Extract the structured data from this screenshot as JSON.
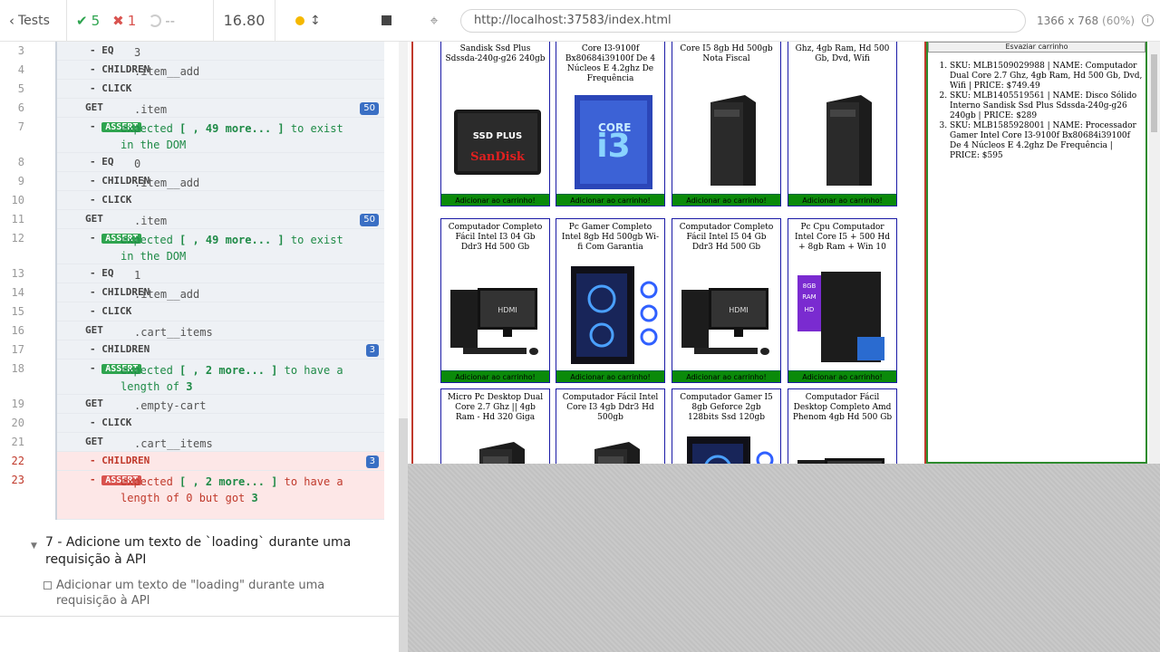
{
  "topbar": {
    "back_label": "Tests",
    "passed": "5",
    "failed": "1",
    "pending": "--",
    "duration": "16.80"
  },
  "commands": [
    {
      "n": "3",
      "name": "- EQ",
      "msg": "3",
      "child": true
    },
    {
      "n": "4",
      "name": "- CHILDREN",
      "msg": ".item__add",
      "child": true
    },
    {
      "n": "5",
      "name": "- CLICK",
      "msg": "",
      "child": true
    },
    {
      "n": "6",
      "name": "GET",
      "msg": ".item",
      "child": false,
      "badge": "50"
    },
    {
      "n": "7",
      "name": "- ASSERT",
      "msg": "expected [ <section.item>, 49 more... ] to exist in the DOM",
      "child": true,
      "assert": true
    },
    {
      "n": "8",
      "name": "- EQ",
      "msg": "0",
      "child": true
    },
    {
      "n": "9",
      "name": "- CHILDREN",
      "msg": ".item__add",
      "child": true
    },
    {
      "n": "10",
      "name": "- CLICK",
      "msg": "",
      "child": true
    },
    {
      "n": "11",
      "name": "GET",
      "msg": ".item",
      "child": false,
      "badge": "50"
    },
    {
      "n": "12",
      "name": "- ASSERT",
      "msg": "expected [ <section.item>, 49 more... ] to exist in the DOM",
      "child": true,
      "assert": true
    },
    {
      "n": "13",
      "name": "- EQ",
      "msg": "1",
      "child": true
    },
    {
      "n": "14",
      "name": "- CHILDREN",
      "msg": ".item__add",
      "child": true
    },
    {
      "n": "15",
      "name": "- CLICK",
      "msg": "",
      "child": true
    },
    {
      "n": "16",
      "name": "GET",
      "msg": ".cart__items",
      "child": false
    },
    {
      "n": "17",
      "name": "- CHILDREN",
      "msg": "",
      "child": true,
      "badge": "3"
    },
    {
      "n": "18",
      "name": "- ASSERT",
      "msg": "expected [ <li.cart__item>, 2 more... ] to have a length of 3",
      "child": true,
      "assert": true
    },
    {
      "n": "19",
      "name": "GET",
      "msg": ".empty-cart",
      "child": false
    },
    {
      "n": "20",
      "name": "- CLICK",
      "msg": "",
      "child": true
    },
    {
      "n": "21",
      "name": "GET",
      "msg": ".cart__items",
      "child": false
    },
    {
      "n": "22",
      "name": "- CHILDREN",
      "msg": "",
      "child": true,
      "badge": "3",
      "fail": true
    },
    {
      "n": "23",
      "name": "- ASSERT",
      "msg": "expected [ <li.cart__item>, 2 more... ] to have a length of 0 but got 3",
      "child": true,
      "assert": true,
      "fail": true
    }
  ],
  "test7": {
    "title": "7 - Adicione um texto de `loading` durante uma requisição à API",
    "sub": "Adicionar um texto de \"loading\" durante uma requisição à API"
  },
  "aut": {
    "url": "http://localhost:37583/index.html",
    "viewport": "1366 x 768",
    "scale": "(60%)"
  },
  "products": [
    {
      "title": "Sandisk Ssd Plus Sdssda-240g-g26 240gb",
      "kind": "ssd"
    },
    {
      "title": "Core I3-9100f Bx80684i39100f De 4 Núcleos E 4.2ghz De Frequência",
      "kind": "cpu"
    },
    {
      "title": "Core I5 8gb Hd 500gb Nota Fiscal",
      "kind": "tower"
    },
    {
      "title": "Ghz, 4gb Ram, Hd 500 Gb, Dvd, Wifi",
      "kind": "tower"
    },
    {
      "title": "Computador Completo Fácil Intel I3 04 Gb Ddr3 Hd 500 Gb",
      "kind": "setup"
    },
    {
      "title": "Pc Gamer Completo Intel 8gb Hd 500gb Wi-fi Com Garantia",
      "kind": "gamer"
    },
    {
      "title": "Computador Completo Fácil Intel I5 04 Gb Ddr3 Hd 500 Gb",
      "kind": "setup"
    },
    {
      "title": "Pc Cpu Computador Intel Core I5 + 500 Hd + 8gb Ram + Win 10",
      "kind": "spec"
    },
    {
      "title": "Micro Pc Desktop Dual Core 2.7 Ghz || 4gb Ram - Hd 320 Giga",
      "kind": "tower"
    },
    {
      "title": "Computador Fácil Intel Core I3 4gb Ddr3 Hd 500gb",
      "kind": "tower"
    },
    {
      "title": "Computador Gamer I5 8gb Geforce 2gb 128bits Ssd 120gb",
      "kind": "gamer"
    },
    {
      "title": "Computador Fácil Desktop Completo Amd Phenom 4gb Hd 500 Gb",
      "kind": "setup"
    }
  ],
  "add_label": "Adicionar ao carrinho!",
  "cart": {
    "empty_label": "Esvaziar carrinho",
    "items": [
      "SKU: MLB1509029988 | NAME: Computador Dual Core 2.7 Ghz, 4gb Ram, Hd 500 Gb, Dvd, Wifi | PRICE: $749.49",
      "SKU: MLB1405519561 | NAME: Disco Sólido Interno Sandisk Ssd Plus Sdssda-240g-g26 240gb | PRICE: $289",
      "SKU: MLB1585928001 | NAME: Processador Gamer Intel Core I3-9100f Bx80684i39100f De 4 Núcleos E 4.2ghz De Frequência | PRICE: $595"
    ]
  },
  "colors": {
    "pass": "#2ea44f",
    "fail": "#d9534f",
    "badge": "#3a6fc4",
    "add_button": "#0a8a0a"
  }
}
